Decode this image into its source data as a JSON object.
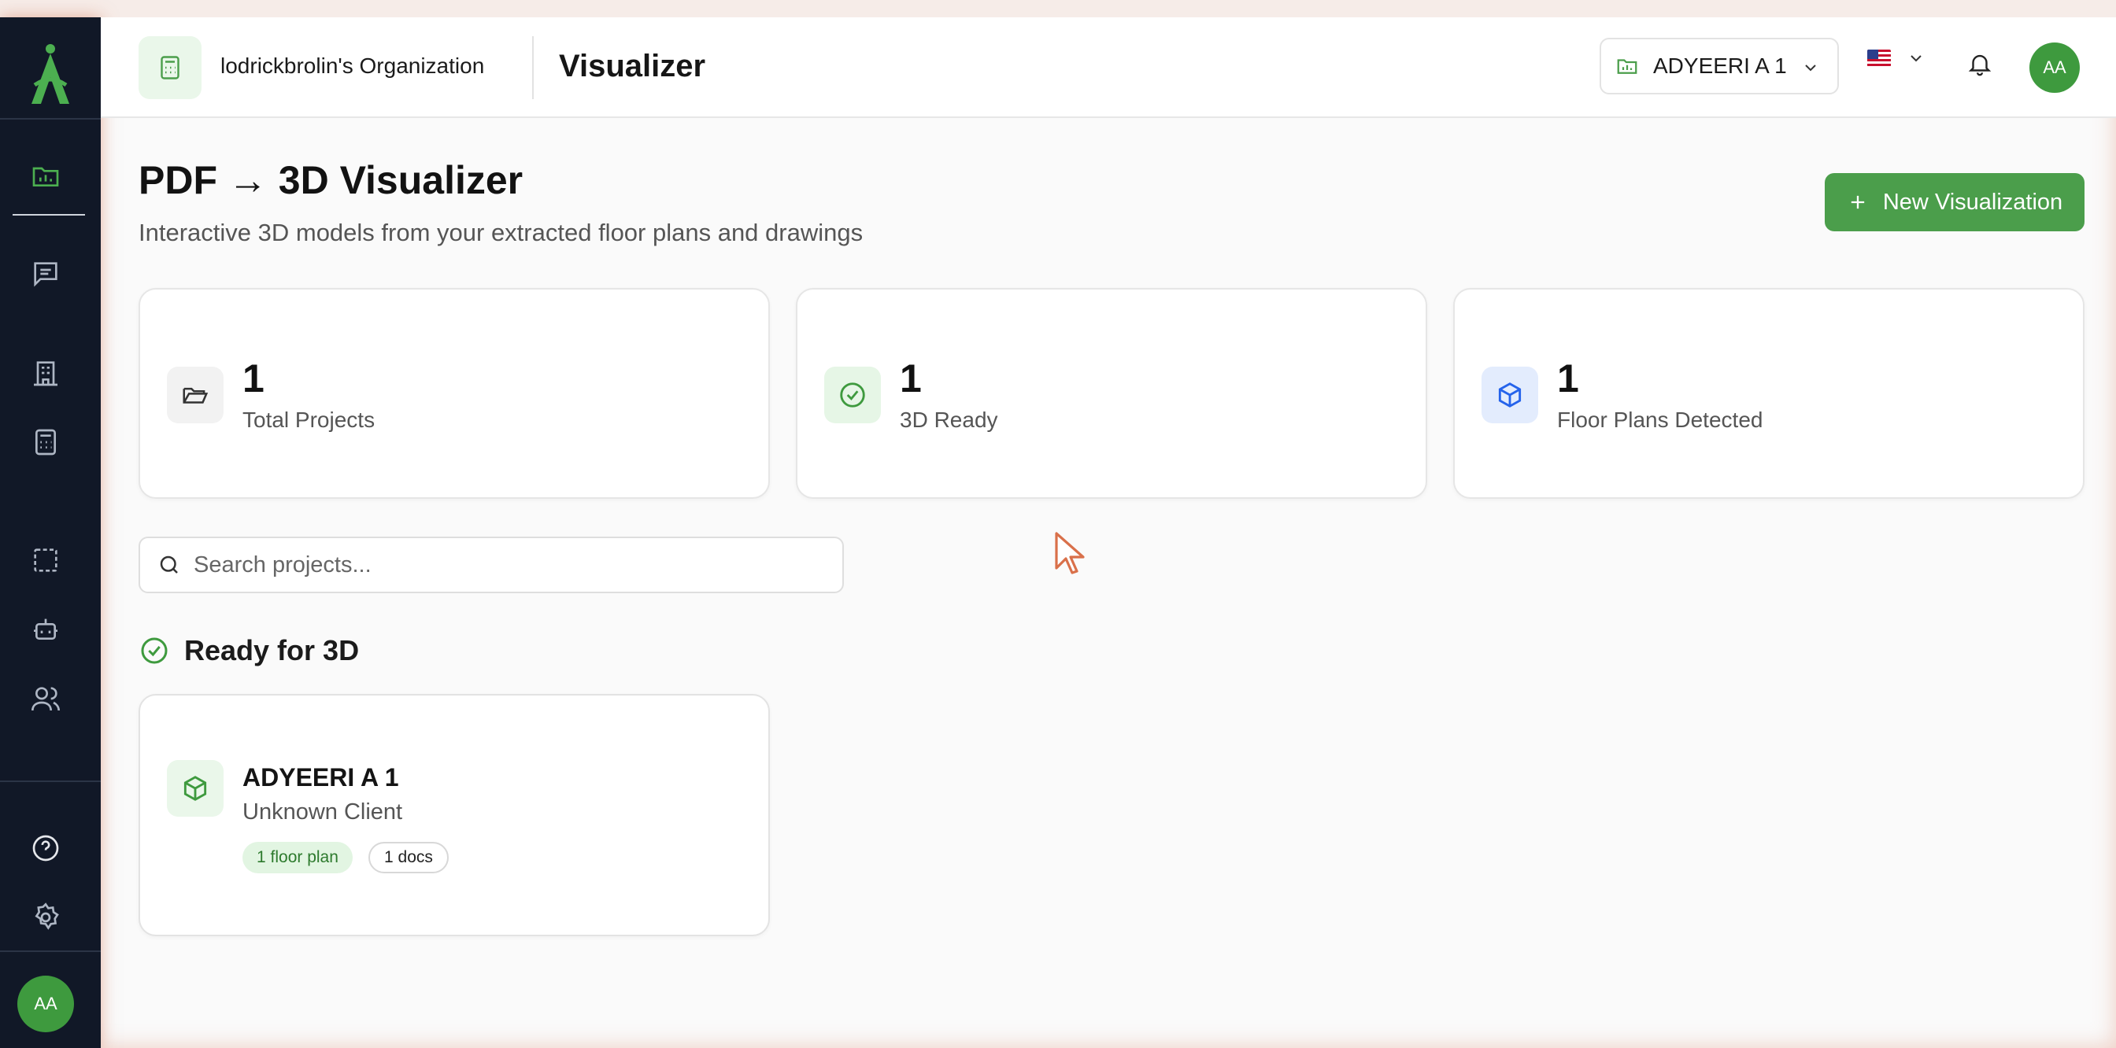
{
  "topbar": {
    "org_name": "lodrickbrolin's Organization",
    "page_name": "Visualizer",
    "project_select": "ADYEERI A 1",
    "user_initials": "AA"
  },
  "sidebar": {
    "user_initials": "AA"
  },
  "main": {
    "title": "PDF → 3D Visualizer",
    "subtitle": "Interactive 3D models from your extracted floor plans and drawings",
    "new_button": "New Visualization",
    "stats": [
      {
        "value": "1",
        "label": "Total Projects",
        "icon": "folder-open-icon"
      },
      {
        "value": "1",
        "label": "3D Ready",
        "icon": "check-circle-icon"
      },
      {
        "value": "1",
        "label": "Floor Plans Detected",
        "icon": "cube-icon"
      }
    ],
    "search": {
      "placeholder": "Search projects..."
    },
    "section_title": "Ready for 3D",
    "projects": [
      {
        "name": "ADYEERI A 1",
        "client": "Unknown Client",
        "badges": [
          "1 floor plan",
          "1 docs"
        ]
      }
    ]
  },
  "colors": {
    "sidebar_bg": "#111827",
    "accent_green": "#4b9e4b",
    "avatar_green": "#3e9a3e",
    "blue_icon": "#2563eb"
  }
}
